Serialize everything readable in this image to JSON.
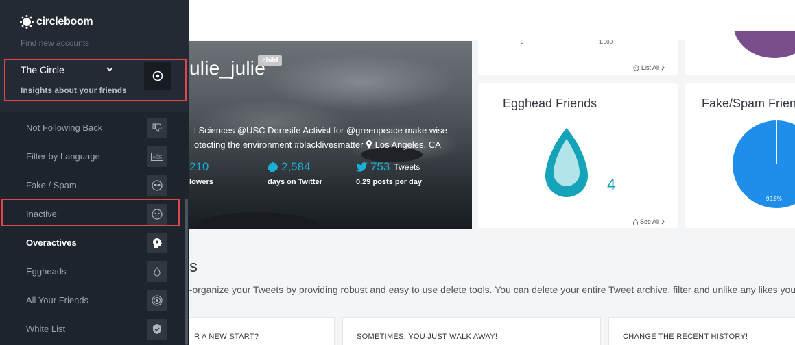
{
  "sidebar": {
    "brand": "circleboom",
    "find_new": "Find new accounts",
    "circle": {
      "title": "The Circle",
      "subtitle": "Insights about your friends"
    },
    "items": [
      {
        "label": "Not Following Back",
        "icon": "thumbs-down-icon"
      },
      {
        "label": "Filter by Language",
        "icon": "language-icon"
      },
      {
        "label": "Fake / Spam",
        "icon": "spy-mask-icon"
      },
      {
        "label": "Inactive",
        "icon": "sleepy-face-icon"
      },
      {
        "label": "Overactives",
        "icon": "head-gear-icon"
      },
      {
        "label": "Eggheads",
        "icon": "egg-icon"
      },
      {
        "label": "All Your Friends",
        "icon": "target-icon"
      },
      {
        "label": "White List",
        "icon": "shield-check-icon"
      }
    ],
    "active_item": "Overactives"
  },
  "profile": {
    "name": "ulie_julie",
    "badge": "child",
    "bio_line1": "l Sciences @USC Dornsife Activist for @greenpeace make wise",
    "bio_line2": "otecting the environment #blacklivesmatter",
    "location": "Los Angeles, CA",
    "stats": [
      {
        "value": "210",
        "label": "lowers"
      },
      {
        "value": "2,584",
        "label": "days on Twitter"
      },
      {
        "value": "753",
        "suffix": "Tweets",
        "label": "0.29 posts per day"
      }
    ]
  },
  "cards": {
    "top_axis": [
      "0",
      "1,000"
    ],
    "list_all": "List All",
    "egghead": {
      "title": "Egghead Friends",
      "count": "4",
      "link": "See All"
    },
    "fake": {
      "title": "Fake/Spam Frien",
      "pie_label": "99.8%"
    }
  },
  "colors": {
    "sidebar_bg": "#232a33",
    "accent_blue": "#1ab0d6",
    "egg_teal": "#14a3b8",
    "pie_blue": "#1e8ee9",
    "pie_purple": "#7a4e8c",
    "highlight_red": "#e0474c"
  },
  "section": {
    "title": "s",
    "desc": "e-organize your Tweets by providing robust and easy to use delete tools. You can delete your entire Tweet archive, filter and unlike any likes you",
    "cards": [
      "R A NEW START?",
      "SOMETIMES, YOU JUST WALK AWAY!",
      "CHANGE THE RECENT HISTORY!"
    ]
  }
}
